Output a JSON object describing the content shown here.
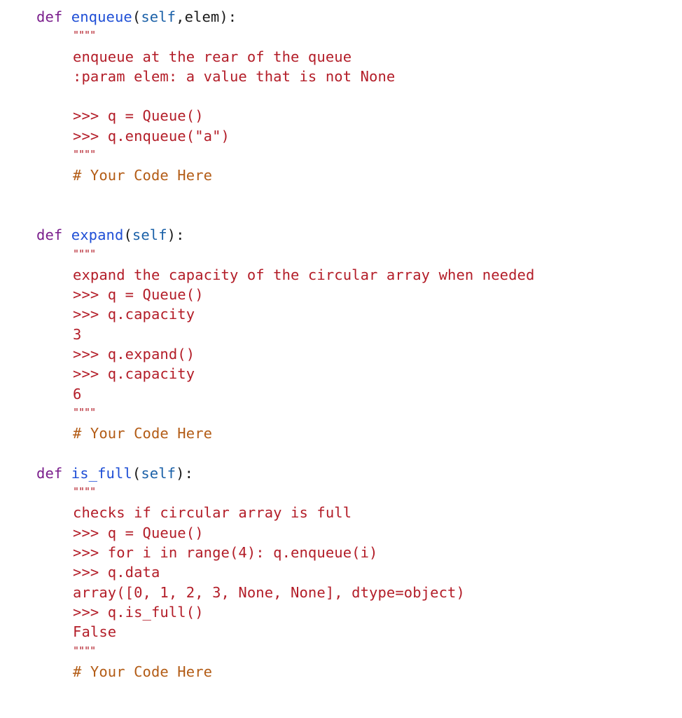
{
  "editor": {
    "functions": [
      {
        "keyword": "def",
        "name": "enqueue",
        "open": "(",
        "self": "self",
        "params_rest": ",elem",
        "close": "):",
        "docstring_quote": "\"\"\"\"",
        "doc_lines": [
          "enqueue at the rear of the queue",
          ":param elem: a value that is not None",
          "",
          ">>> q = Queue()",
          ">>> q.enqueue(\"a\")"
        ],
        "comment": "# Your Code Here"
      },
      {
        "keyword": "def",
        "name": "expand",
        "open": "(",
        "self": "self",
        "params_rest": "",
        "close": "):",
        "docstring_quote": "\"\"\"\"",
        "doc_lines": [
          "expand the capacity of the circular array when needed",
          ">>> q = Queue()",
          ">>> q.capacity",
          "3",
          ">>> q.expand()",
          ">>> q.capacity",
          "6"
        ],
        "comment": "# Your Code Here"
      },
      {
        "keyword": "def",
        "name": "is_full",
        "open": "(",
        "self": "self",
        "params_rest": "",
        "close": "):",
        "docstring_quote": "\"\"\"\"",
        "doc_lines": [
          "checks if circular array is full",
          ">>> q = Queue()",
          ">>> for i in range(4): q.enqueue(i)",
          ">>> q.data",
          "array([0, 1, 2, 3, None, None], dtype=object)",
          ">>> q.is_full()",
          "False"
        ],
        "comment": "# Your Code Here"
      }
    ],
    "colors": {
      "keyword": "#7a1e8c",
      "function_name": "#1f4fd6",
      "self": "#1b61a8",
      "docstring": "#b31d28",
      "comment": "#b35c16"
    }
  }
}
